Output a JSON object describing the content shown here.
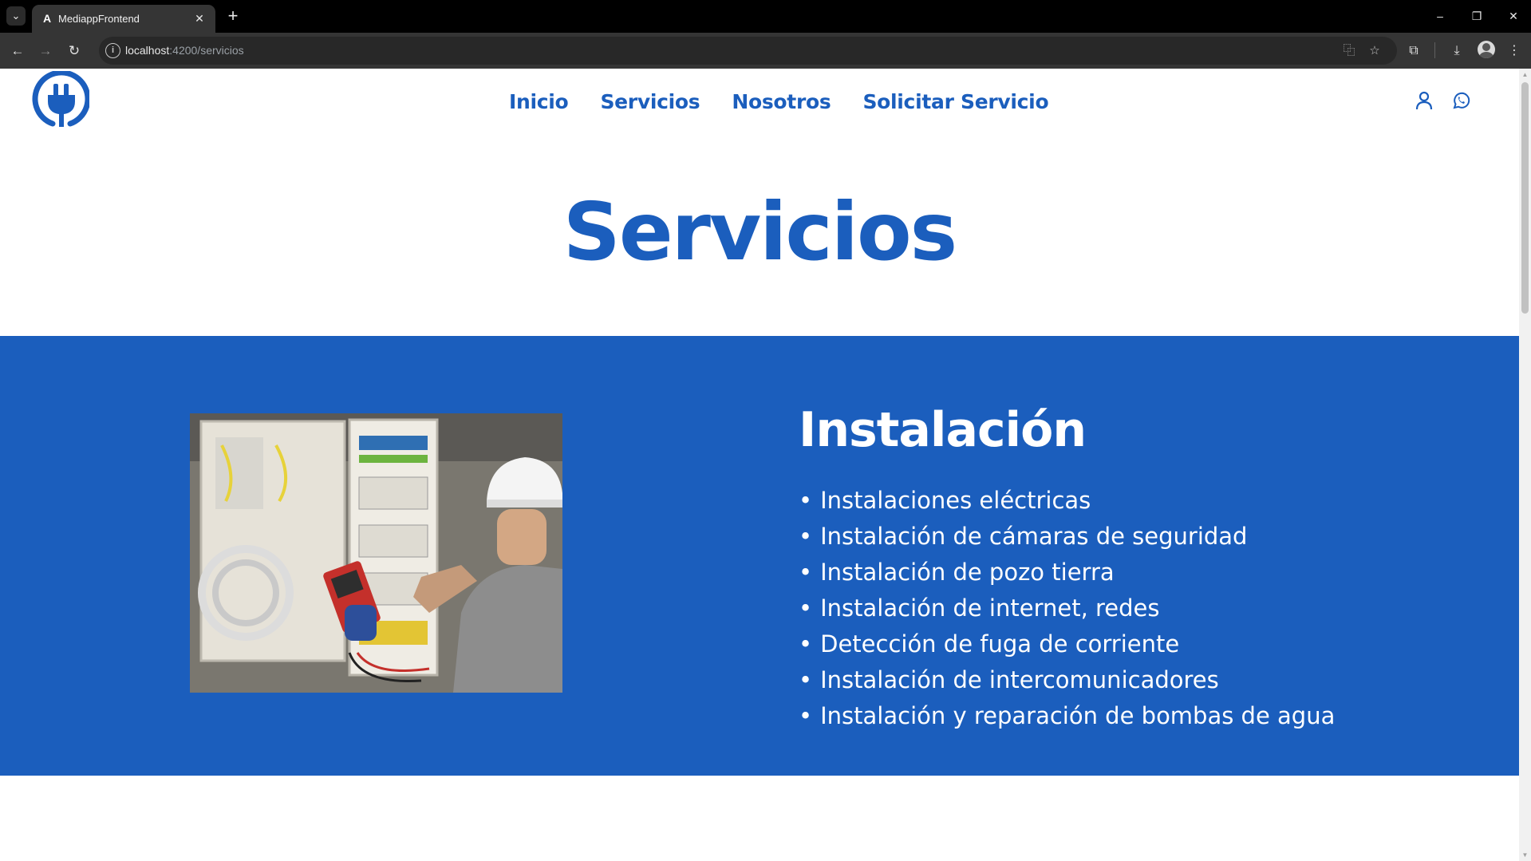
{
  "browser": {
    "tab_title": "MediappFrontend",
    "tab_favicon": "A",
    "url_host": "localhost",
    "url_path": ":4200/servicios"
  },
  "header": {
    "nav": [
      "Inicio",
      "Servicios",
      "Nosotros",
      "Solicitar Servicio"
    ]
  },
  "page": {
    "title": "Servicios"
  },
  "service": {
    "heading": "Instalación",
    "bullet": "•",
    "items": [
      "Instalaciones eléctricas",
      "Instalación de cámaras de seguridad",
      "Instalación de pozo tierra",
      "Instalación de internet, redes",
      "Detección de fuga de corriente",
      "Instalación de intercomunicadores",
      "Instalación y reparación de bombas de agua"
    ]
  },
  "colors": {
    "brand_blue": "#1b5ebd",
    "text_on_blue": "#ffffff"
  }
}
